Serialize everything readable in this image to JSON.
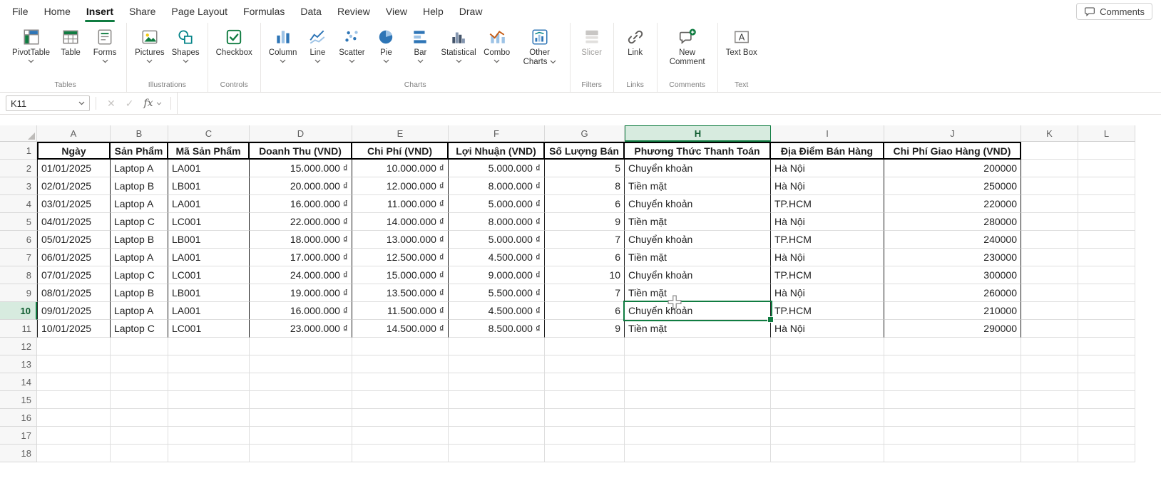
{
  "colors": {
    "accent": "#107C41",
    "selection_bg": "#D7EBDF",
    "chart_blue": "#2E75B6"
  },
  "menu_bar": {
    "tabs": [
      "File",
      "Home",
      "Insert",
      "Share",
      "Page Layout",
      "Formulas",
      "Data",
      "Review",
      "View",
      "Help",
      "Draw"
    ],
    "active_tab": "Insert",
    "comments_button": {
      "label": "Comments",
      "icon": "comments-icon"
    }
  },
  "ribbon": {
    "groups": [
      {
        "label": "Tables",
        "buttons": [
          {
            "label": "PivotTable",
            "icon": "pivottable-icon",
            "dropdown": true
          },
          {
            "label": "Table",
            "icon": "table-icon"
          },
          {
            "label": "Forms",
            "icon": "forms-icon",
            "dropdown": true
          }
        ]
      },
      {
        "label": "Illustrations",
        "buttons": [
          {
            "label": "Pictures",
            "icon": "pictures-icon",
            "dropdown": true
          },
          {
            "label": "Shapes",
            "icon": "shapes-icon",
            "dropdown": true
          }
        ]
      },
      {
        "label": "Controls",
        "buttons": [
          {
            "label": "Checkbox",
            "icon": "checkbox-icon"
          }
        ]
      },
      {
        "label": "Charts",
        "buttons": [
          {
            "label": "Column",
            "icon": "column-chart-icon",
            "dropdown": true
          },
          {
            "label": "Line",
            "icon": "line-chart-icon",
            "dropdown": true
          },
          {
            "label": "Scatter",
            "icon": "scatter-chart-icon",
            "dropdown": true
          },
          {
            "label": "Pie",
            "icon": "pie-chart-icon",
            "dropdown": true
          },
          {
            "label": "Bar",
            "icon": "bar-chart-icon",
            "dropdown": true
          },
          {
            "label": "Statistical",
            "icon": "statistical-chart-icon",
            "dropdown": true
          },
          {
            "label": "Combo",
            "icon": "combo-chart-icon",
            "dropdown": true
          },
          {
            "label": "Other Charts",
            "icon": "other-charts-icon",
            "dropdown": true,
            "chevron_inline": true
          }
        ]
      },
      {
        "label": "Filters",
        "buttons": [
          {
            "label": "Slicer",
            "icon": "slicer-icon",
            "disabled": true
          }
        ]
      },
      {
        "label": "Links",
        "buttons": [
          {
            "label": "Link",
            "icon": "link-icon"
          }
        ]
      },
      {
        "label": "Comments",
        "buttons": [
          {
            "label": "New Comment",
            "icon": "new-comment-icon"
          }
        ]
      },
      {
        "label": "Text",
        "buttons": [
          {
            "label": "Text Box",
            "icon": "text-box-icon"
          }
        ]
      }
    ]
  },
  "formula_bar": {
    "name_box_value": "K11",
    "fx_label": "fx",
    "formula_value": ""
  },
  "sheet": {
    "column_letters": [
      "A",
      "B",
      "C",
      "D",
      "E",
      "F",
      "G",
      "H",
      "I",
      "J",
      "K",
      "L"
    ],
    "selected_column": "H",
    "selected_row_number": 10,
    "active_cell": {
      "column": "H",
      "row": 10,
      "value": "Chuyển khoản"
    },
    "visible_row_count": 18,
    "table": {
      "header": [
        "Ngày",
        "Sản Phẩm",
        "Mã Sản Phẩm",
        "Doanh Thu (VND)",
        "Chi Phí (VND)",
        "Lợi Nhuận (VND)",
        "Số Lượng Bán",
        "Phương Thức Thanh Toán",
        "Địa Điểm Bán Hàng",
        "Chi Phí Giao Hàng (VND)"
      ],
      "rows": [
        [
          "01/01/2025",
          "Laptop A",
          "LA001",
          "15.000.000 ₫",
          "10.000.000 ₫",
          "5.000.000 ₫",
          "5",
          "Chuyển khoản",
          "Hà Nội",
          "200000"
        ],
        [
          "02/01/2025",
          "Laptop B",
          "LB001",
          "20.000.000 ₫",
          "12.000.000 ₫",
          "8.000.000 ₫",
          "8",
          "Tiền mặt",
          "Hà Nội",
          "250000"
        ],
        [
          "03/01/2025",
          "Laptop A",
          "LA001",
          "16.000.000 ₫",
          "11.000.000 ₫",
          "5.000.000 ₫",
          "6",
          "Chuyển khoản",
          "TP.HCM",
          "220000"
        ],
        [
          "04/01/2025",
          "Laptop C",
          "LC001",
          "22.000.000 ₫",
          "14.000.000 ₫",
          "8.000.000 ₫",
          "9",
          "Tiền mặt",
          "Hà Nội",
          "280000"
        ],
        [
          "05/01/2025",
          "Laptop B",
          "LB001",
          "18.000.000 ₫",
          "13.000.000 ₫",
          "5.000.000 ₫",
          "7",
          "Chuyển khoản",
          "TP.HCM",
          "240000"
        ],
        [
          "06/01/2025",
          "Laptop A",
          "LA001",
          "17.000.000 ₫",
          "12.500.000 ₫",
          "4.500.000 ₫",
          "6",
          "Tiền mặt",
          "Hà Nội",
          "230000"
        ],
        [
          "07/01/2025",
          "Laptop C",
          "LC001",
          "24.000.000 ₫",
          "15.000.000 ₫",
          "9.000.000 ₫",
          "10",
          "Chuyển khoản",
          "TP.HCM",
          "300000"
        ],
        [
          "08/01/2025",
          "Laptop B",
          "LB001",
          "19.000.000 ₫",
          "13.500.000 ₫",
          "5.500.000 ₫",
          "7",
          "Tiền mặt",
          "Hà Nội",
          "260000"
        ],
        [
          "09/01/2025",
          "Laptop A",
          "LA001",
          "16.000.000 ₫",
          "11.500.000 ₫",
          "4.500.000 ₫",
          "6",
          "Chuyển khoản",
          "TP.HCM",
          "210000"
        ],
        [
          "10/01/2025",
          "Laptop C",
          "LC001",
          "23.000.000 ₫",
          "14.500.000 ₫",
          "8.500.000 ₫",
          "9",
          "Tiền mặt",
          "Hà Nội",
          "290000"
        ]
      ]
    }
  }
}
